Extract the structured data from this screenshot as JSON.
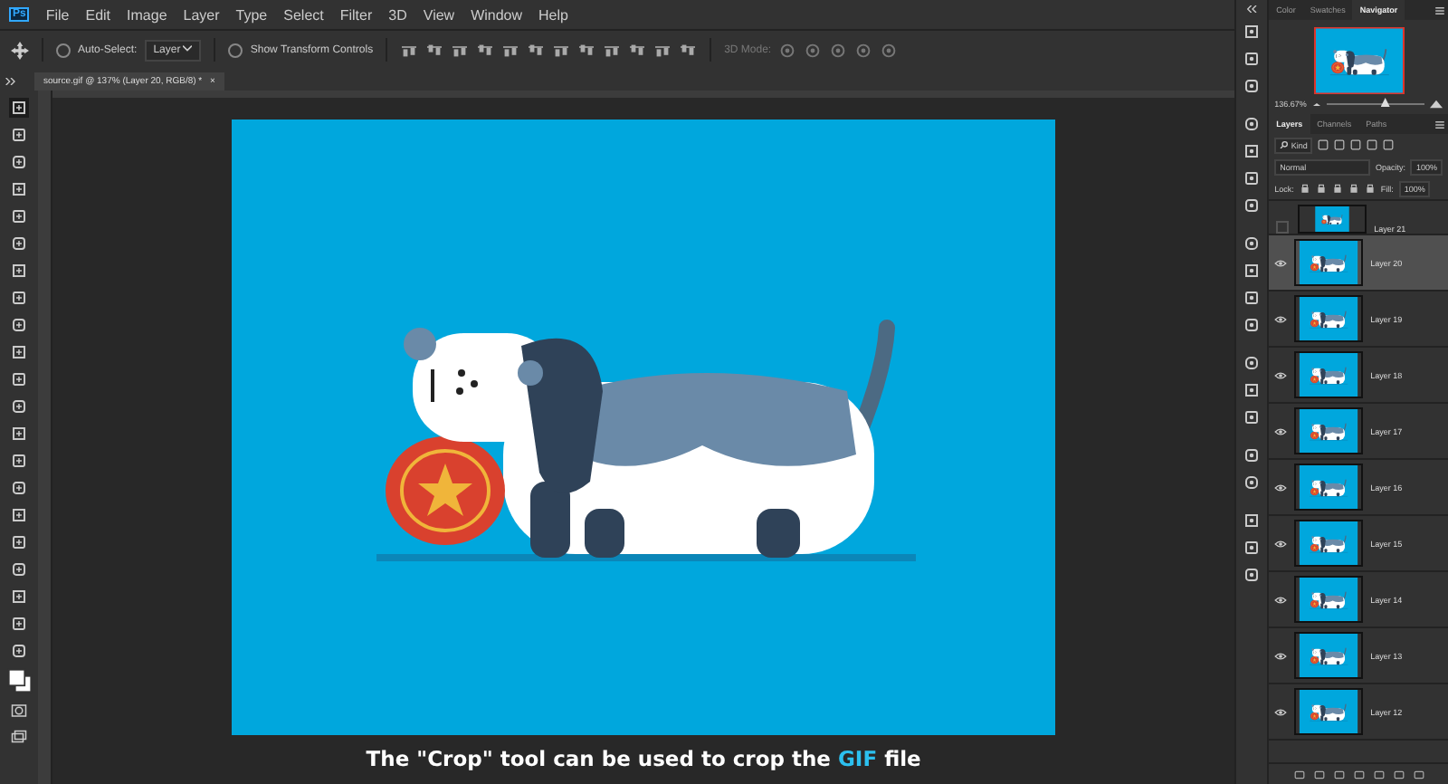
{
  "menu_bar": {
    "app_badge": "Ps",
    "items": [
      "File",
      "Edit",
      "Image",
      "Layer",
      "Type",
      "Select",
      "Filter",
      "3D",
      "View",
      "Window",
      "Help"
    ]
  },
  "options_bar": {
    "auto_select": {
      "label": "Auto-Select:",
      "checked": false
    },
    "target": "Layer",
    "transform_controls": {
      "label": "Show Transform Controls",
      "checked": false
    },
    "mode_label": "3D Mode:"
  },
  "document_tab": {
    "title": "source.gif @ 137% (Layer 20, RGB/8) *",
    "close": "×"
  },
  "caption": [
    {
      "text": "The \"Crop\" tool can be used to crop the ",
      "highlight": false
    },
    {
      "text": "GIF",
      "highlight": true
    },
    {
      "text": " file",
      "highlight": false
    }
  ],
  "navigator": {
    "tabs": [
      {
        "label": "Color",
        "selected": false
      },
      {
        "label": "Swatches",
        "selected": false
      },
      {
        "label": "Navigator",
        "selected": true
      }
    ],
    "zoom": "136.67%",
    "level": 0.6
  },
  "layers_panel": {
    "tabs": [
      {
        "label": "Layers",
        "selected": true
      },
      {
        "label": "Channels",
        "selected": false
      },
      {
        "label": "Paths",
        "selected": false
      }
    ],
    "filter": "Kind",
    "blend_mode": "Normal",
    "opacity_label": "Opacity:",
    "opacity": "100%",
    "lock_label": "Lock:",
    "fill_label": "Fill:",
    "fill": "100%",
    "layers": [
      {
        "name": "Layer 21",
        "visible": false,
        "selected": false
      },
      {
        "name": "Layer 20",
        "visible": true,
        "selected": true
      },
      {
        "name": "Layer 19",
        "visible": true,
        "selected": false
      },
      {
        "name": "Layer 18",
        "visible": true,
        "selected": false
      },
      {
        "name": "Layer 17",
        "visible": true,
        "selected": false
      },
      {
        "name": "Layer 16",
        "visible": true,
        "selected": false
      },
      {
        "name": "Layer 15",
        "visible": true,
        "selected": false
      },
      {
        "name": "Layer 14",
        "visible": true,
        "selected": false
      },
      {
        "name": "Layer 13",
        "visible": true,
        "selected": false
      },
      {
        "name": "Layer 12",
        "visible": true,
        "selected": false
      }
    ]
  }
}
